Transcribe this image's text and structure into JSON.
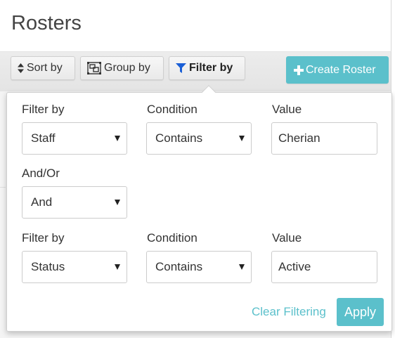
{
  "header": {
    "title": "Rosters"
  },
  "toolbar": {
    "sort_label": "Sort by",
    "group_label": "Group by",
    "filter_label": "Filter by",
    "create_label": "Create Roster",
    "accent_color": "#5bc0cb"
  },
  "filter_panel": {
    "row1": {
      "filter_by_label": "Filter by",
      "filter_by_value": "Staff",
      "condition_label": "Condition",
      "condition_value": "Contains",
      "value_label": "Value",
      "value_value": "Cherian"
    },
    "andor": {
      "label": "And/Or",
      "value": "And"
    },
    "row2": {
      "filter_by_label": "Filter by",
      "filter_by_value": "Status",
      "condition_label": "Condition",
      "condition_value": "Contains",
      "value_label": "Value",
      "value_value": "Active"
    },
    "clear_label": "Clear Filtering",
    "apply_label": "Apply"
  }
}
